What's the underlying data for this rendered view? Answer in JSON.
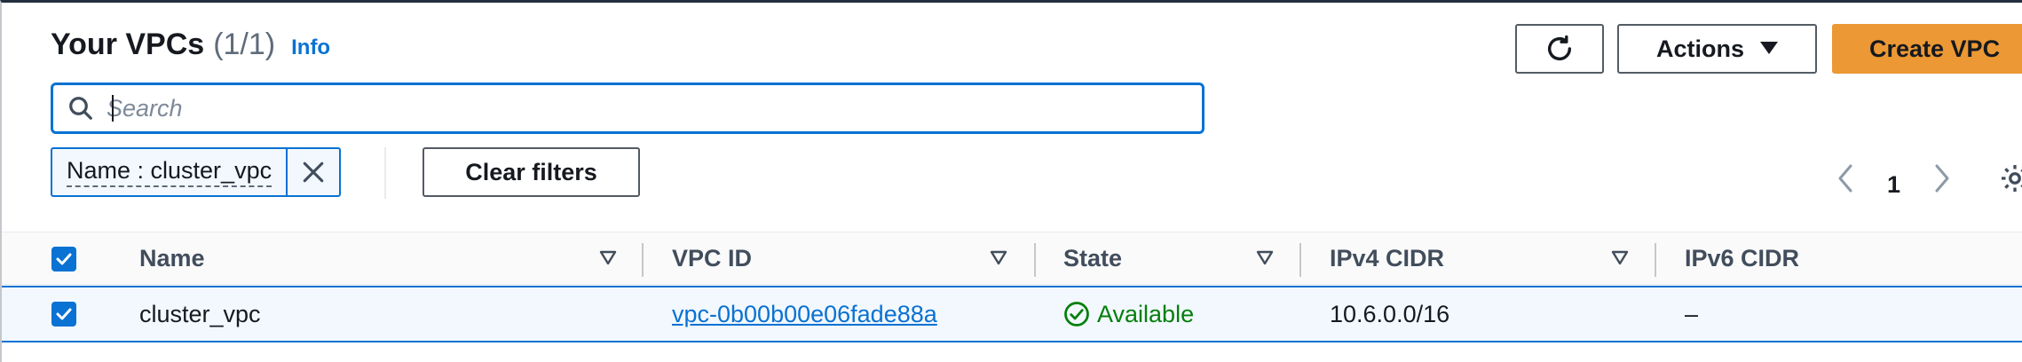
{
  "header": {
    "title": "Your VPCs",
    "count": "(1/1)",
    "info_label": "Info"
  },
  "toolbar": {
    "refresh_icon": "refresh-icon",
    "actions_label": "Actions",
    "create_label": "Create VPC"
  },
  "search": {
    "placeholder": "Search",
    "value": ""
  },
  "filters": {
    "tokens": [
      {
        "label": "Name : cluster_vpc"
      }
    ],
    "clear_label": "Clear filters"
  },
  "pagination": {
    "current_page": "1"
  },
  "table": {
    "columns": [
      "Name",
      "VPC ID",
      "State",
      "IPv4 CIDR",
      "IPv6 CIDR"
    ],
    "rows": [
      {
        "selected": true,
        "name": "cluster_vpc",
        "vpc_id": "vpc-0b00b00e06fade88a",
        "state": "Available",
        "ipv4_cidr": "10.6.0.0/16",
        "ipv6_cidr": "–"
      }
    ]
  },
  "colors": {
    "accent": "#0972d3",
    "primary_button": "#ec9834",
    "success": "#037f0c"
  }
}
